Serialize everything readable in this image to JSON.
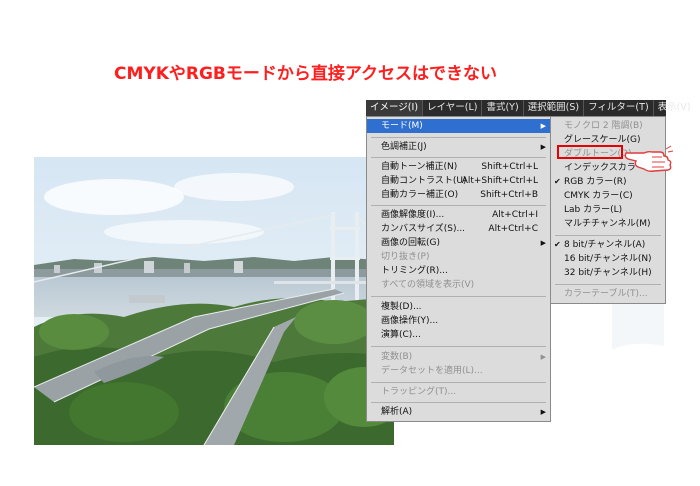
{
  "headline": "CMYKやRGBモードから直接アクセスはできない",
  "menubar": {
    "items": [
      {
        "label": "イメージ(I)",
        "active": true
      },
      {
        "label": "レイヤー(L)",
        "active": false
      },
      {
        "label": "書式(Y)",
        "active": false
      },
      {
        "label": "選択範囲(S)",
        "active": false
      },
      {
        "label": "フィルター(T)",
        "active": false
      },
      {
        "label": "表示(V)",
        "active": false
      }
    ]
  },
  "image_menu": {
    "mode": "モード(M)",
    "adjustments": "色調補正(J)",
    "auto_tone": "自動トーン補正(N)",
    "auto_tone_sc": "Shift+Ctrl+L",
    "auto_contrast": "自動コントラスト(U)",
    "auto_contrast_sc": "Alt+Shift+Ctrl+L",
    "auto_color": "自動カラー補正(O)",
    "auto_color_sc": "Shift+Ctrl+B",
    "image_size": "画像解像度(I)...",
    "image_size_sc": "Alt+Ctrl+I",
    "canvas_size": "カンバスサイズ(S)...",
    "canvas_size_sc": "Alt+Ctrl+C",
    "rotation": "画像の回転(G)",
    "crop": "切り抜き(P)",
    "trim": "トリミング(R)...",
    "reveal_all": "すべての領域を表示(V)",
    "duplicate": "複製(D)...",
    "apply_image": "画像操作(Y)...",
    "calculations": "演算(C)...",
    "variables": "変数(B)",
    "apply_dataset": "データセットを適用(L)...",
    "trap": "トラッピング(T)...",
    "analysis": "解析(A)"
  },
  "mode_submenu": {
    "bitmap": "モノクロ 2 階調(B)",
    "grayscale": "グレースケール(G)",
    "duotone": "ダブルトーン(D)",
    "indexed": "インデックスカラー(I)...",
    "rgb": "RGB カラー(R)",
    "cmyk": "CMYK カラー(C)",
    "lab": "Lab カラー(L)",
    "multichannel": "マルチチャンネル(M)",
    "bit8": "8 bit/チャンネル(A)",
    "bit16": "16 bit/チャンネル(N)",
    "bit32": "32 bit/チャンネル(H)",
    "color_table": "カラーテーブル(T)...",
    "check": "✔"
  },
  "colors": {
    "headline": "#ff1e1e",
    "highlight": "#2f6fcf",
    "menubar": "#2b2b2b",
    "menu_bg": "#dcdcdc",
    "redbox": "#e60000"
  }
}
